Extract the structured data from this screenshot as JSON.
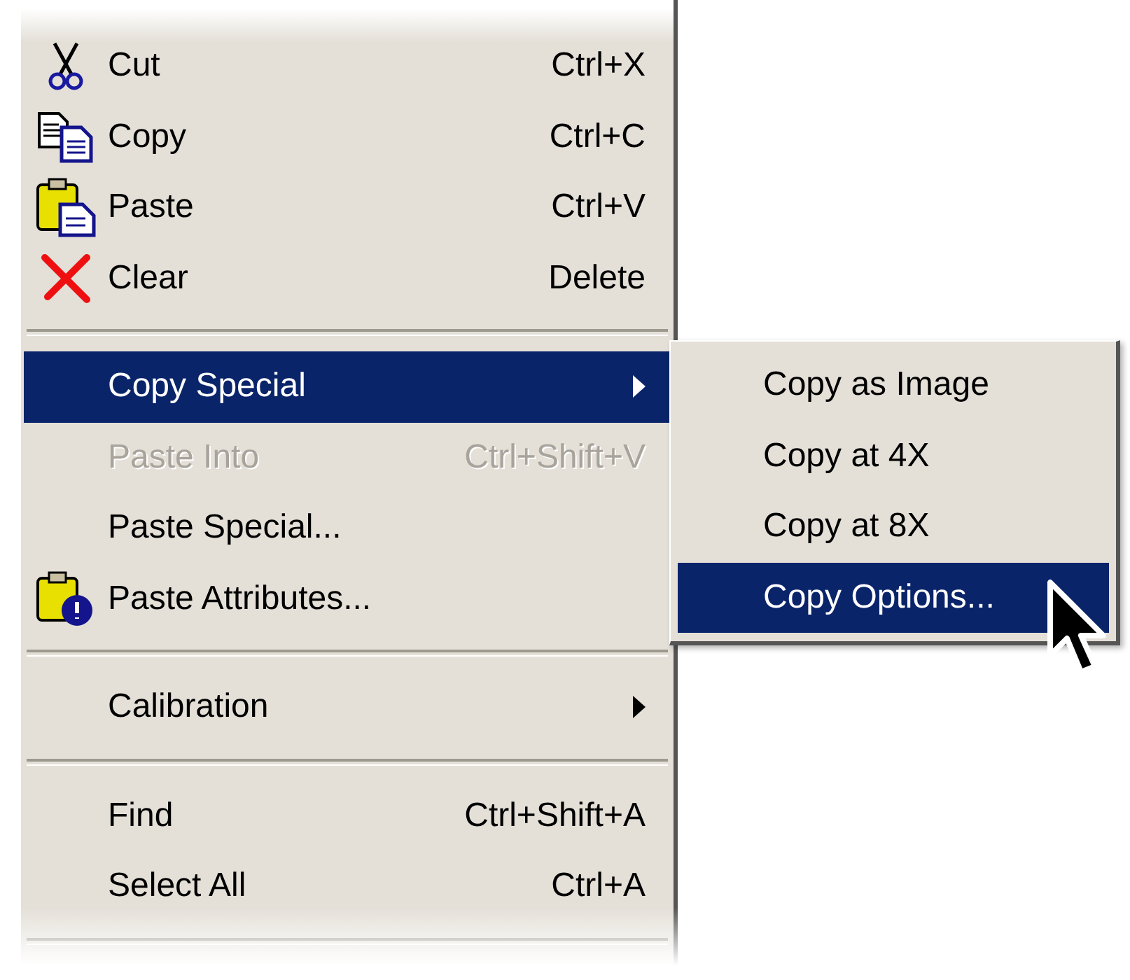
{
  "menu": {
    "items": [
      {
        "kind": "item",
        "label": "Cut",
        "shortcut": "Ctrl+X",
        "selected": false,
        "disabled": false,
        "submenu": false
      },
      {
        "kind": "item",
        "label": "Copy",
        "shortcut": "Ctrl+C",
        "selected": false,
        "disabled": false,
        "submenu": false
      },
      {
        "kind": "item",
        "label": "Paste",
        "shortcut": "Ctrl+V",
        "selected": false,
        "disabled": false,
        "submenu": false
      },
      {
        "kind": "item",
        "label": "Clear",
        "shortcut": "Delete",
        "selected": false,
        "disabled": false,
        "submenu": false
      },
      {
        "kind": "separator"
      },
      {
        "kind": "item",
        "label": "Copy Special",
        "selected": true,
        "disabled": false,
        "submenu": true
      },
      {
        "kind": "item",
        "label": "Paste Into",
        "shortcut": "Ctrl+Shift+V",
        "selected": false,
        "disabled": true,
        "submenu": false
      },
      {
        "kind": "item",
        "label": "Paste Special...",
        "selected": false,
        "disabled": false,
        "submenu": false
      },
      {
        "kind": "item",
        "label": "Paste Attributes...",
        "selected": false,
        "disabled": false,
        "submenu": false
      },
      {
        "kind": "separator"
      },
      {
        "kind": "item",
        "label": "Calibration",
        "selected": false,
        "disabled": false,
        "submenu": true
      },
      {
        "kind": "separator"
      },
      {
        "kind": "item",
        "label": "Find",
        "shortcut": "Ctrl+Shift+A",
        "selected": false,
        "disabled": false,
        "submenu": false
      },
      {
        "kind": "item",
        "label": "Select All",
        "shortcut": "Ctrl+A",
        "selected": false,
        "disabled": false,
        "submenu": false
      },
      {
        "kind": "separator"
      }
    ]
  },
  "submenu": {
    "items": [
      {
        "label": "Copy as Image",
        "selected": false
      },
      {
        "label": "Copy at 4X",
        "selected": false
      },
      {
        "label": "Copy at 8X",
        "selected": false
      },
      {
        "label": "Copy Options...",
        "selected": true
      }
    ]
  }
}
